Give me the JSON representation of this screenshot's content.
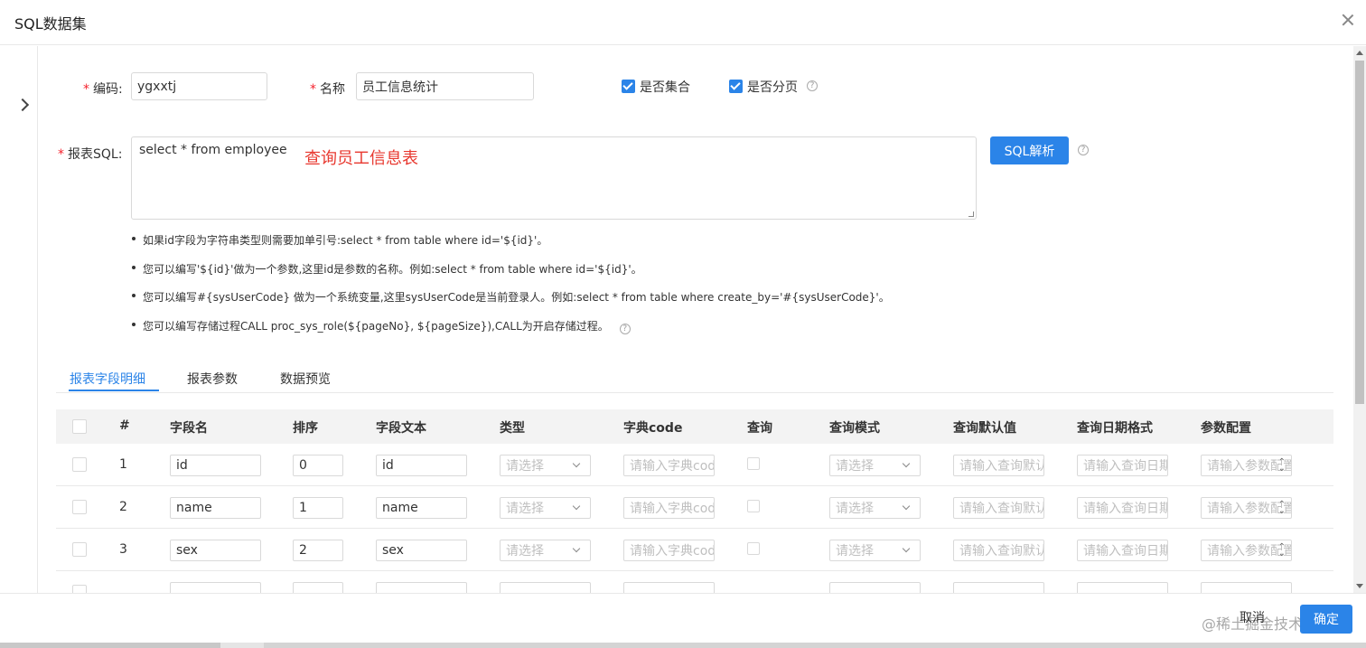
{
  "dialog": {
    "title": "SQL数据集"
  },
  "form": {
    "code_label": "编码:",
    "code_value": "ygxxtj",
    "name_label": "名称",
    "name_value": "员工信息统计",
    "is_set_label": "是否集合",
    "is_paged_label": "是否分页",
    "sql_label": "报表SQL:",
    "sql_value": "select * from employee",
    "sql_annotation": "查询员工信息表",
    "parse_button": "SQL解析"
  },
  "tips": [
    "如果id字段为字符串类型则需要加单引号:select * from table where id='${id}'。",
    "您可以编写'${id}'做为一个参数,这里id是参数的名称。例如:select * from table where id='${id}'。",
    "您可以编写#{sysUserCode} 做为一个系统变量,这里sysUserCode是当前登录人。例如:select * from table where create_by='#{sysUserCode}'。",
    "您可以编写存储过程CALL proc_sys_role(${pageNo}, ${pageSize}),CALL为开启存储过程。"
  ],
  "tabs": [
    "报表字段明细",
    "报表参数",
    "数据预览"
  ],
  "table": {
    "headers": [
      "#",
      "字段名",
      "排序",
      "字段文本",
      "类型",
      "字典code",
      "查询",
      "查询模式",
      "查询默认值",
      "查询日期格式",
      "参数配置"
    ],
    "placeholders": {
      "type": "请选择",
      "dict": "请输入字典code",
      "mode": "请选择",
      "default": "请输入查询默认值",
      "date_format": "请输入查询日期格式",
      "param": "请输入参数配置"
    },
    "rows": [
      {
        "index": "1",
        "field": "id",
        "order": "0",
        "text": "id"
      },
      {
        "index": "2",
        "field": "name",
        "order": "1",
        "text": "name"
      },
      {
        "index": "3",
        "field": "sex",
        "order": "2",
        "text": "sex"
      }
    ]
  },
  "footer": {
    "cancel": "取消",
    "ok": "确定",
    "watermark": "@稀土掘金技术社区"
  },
  "colors": {
    "primary": "#2b84e8",
    "annotation": "#e8382f",
    "required": "#f5222d"
  }
}
